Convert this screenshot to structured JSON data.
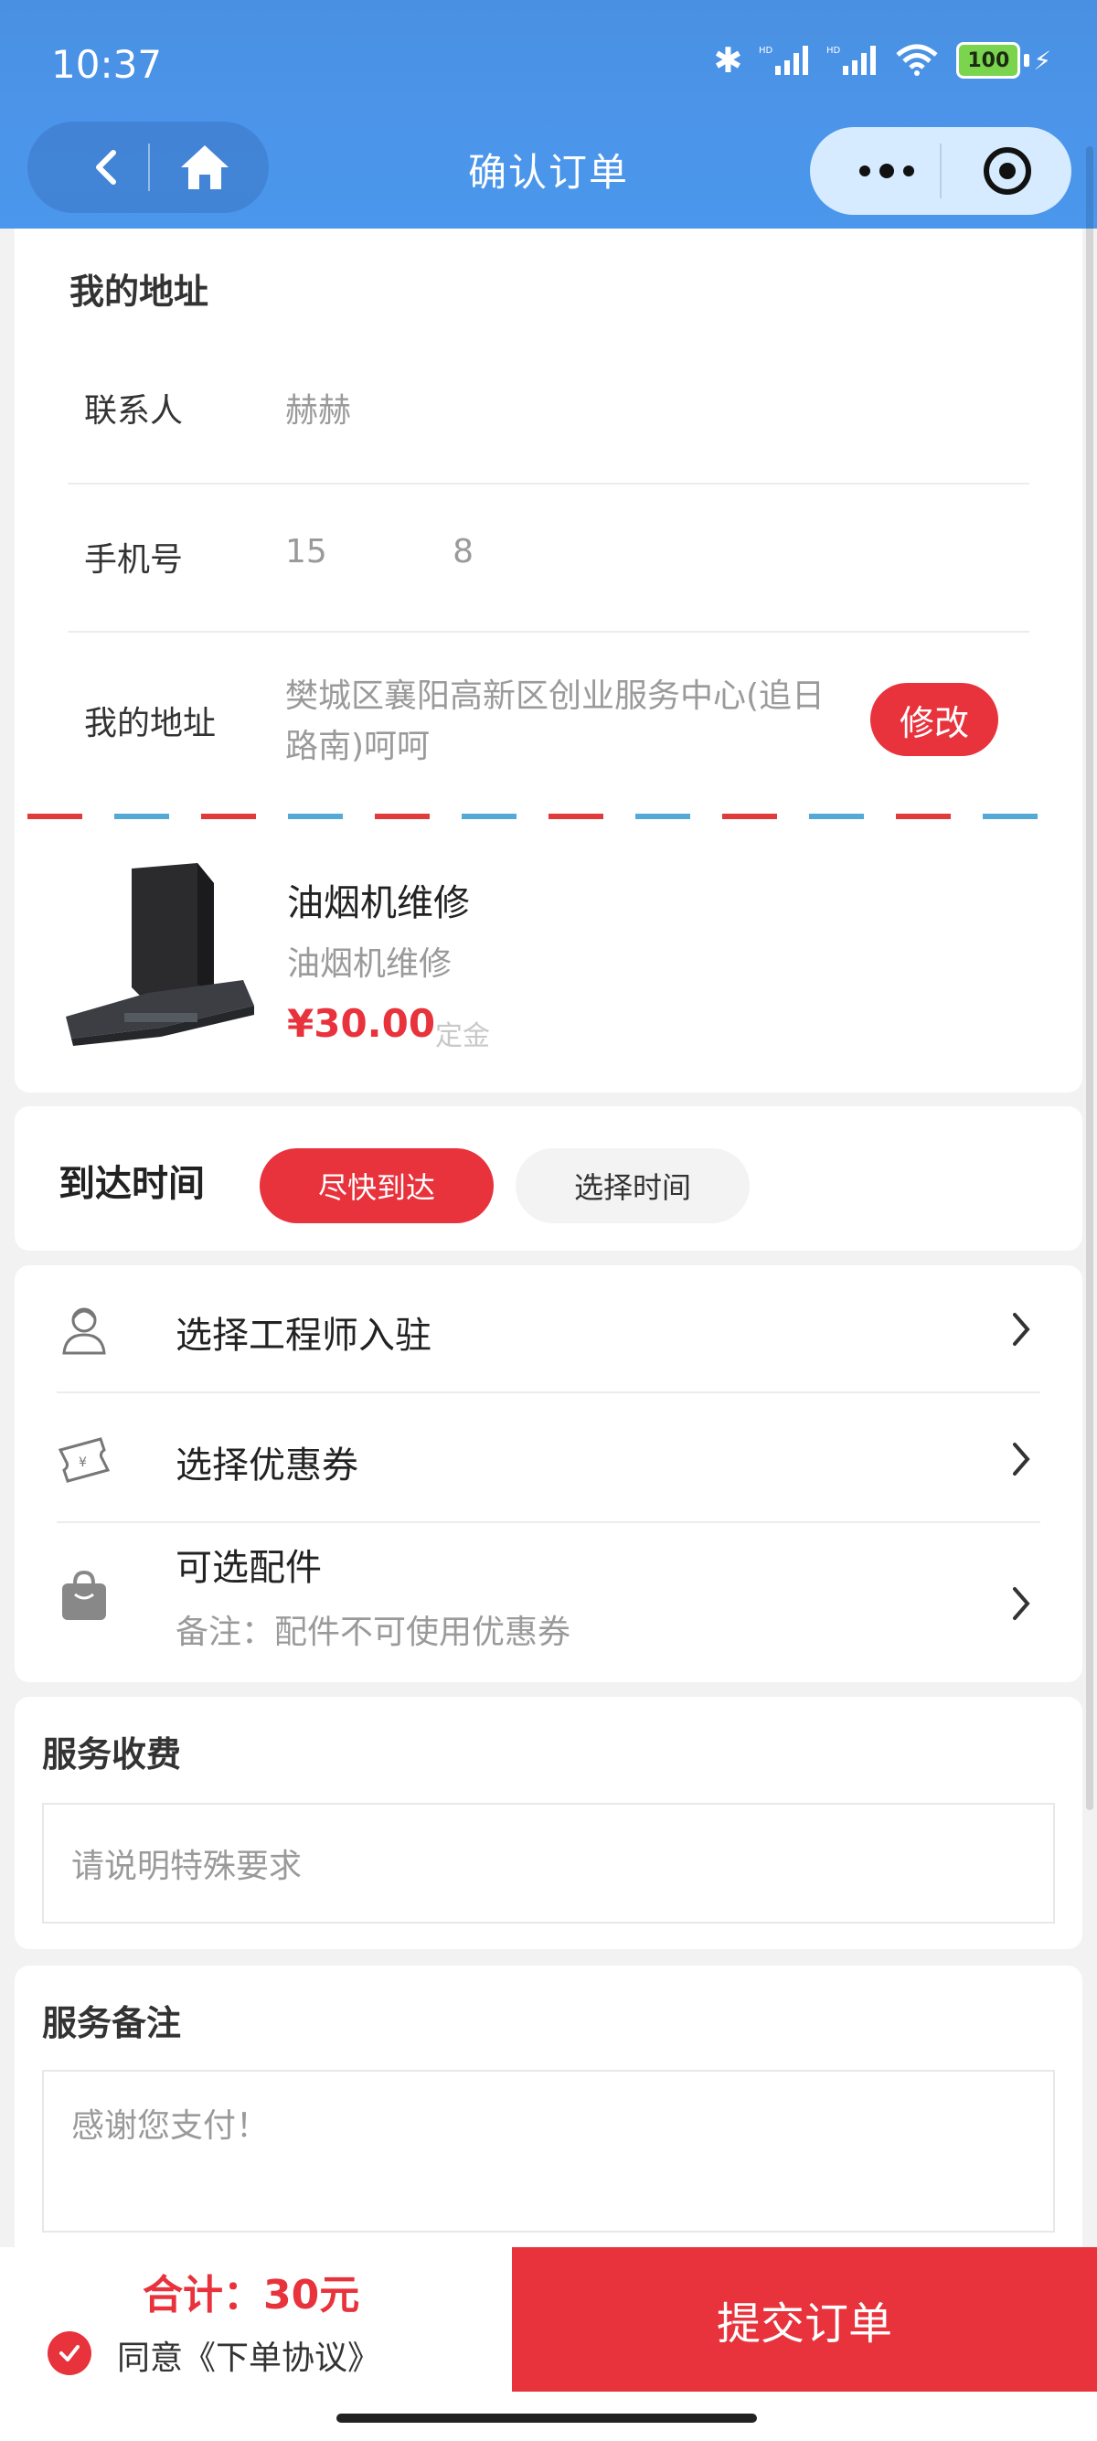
{
  "status_bar": {
    "time": "10:37",
    "battery": "100"
  },
  "nav": {
    "title": "确认订单"
  },
  "address": {
    "section_title": "我的地址",
    "contact_label": "联系人",
    "contact_value": "赫赫",
    "phone_label": "手机号",
    "phone_value": "15            8",
    "address_label": "我的地址",
    "address_value": "樊城区襄阳高新区创业服务中心(追日路南)呵呵",
    "edit_button": "修改"
  },
  "product": {
    "name": "油烟机维修",
    "subtitle": "油烟机维修",
    "price": "¥30.00",
    "price_unit": "定金"
  },
  "arrival": {
    "label": "到达时间",
    "option_asap": "尽快到达",
    "option_choose": "选择时间"
  },
  "options": [
    {
      "label": "选择工程师入驻",
      "icon": "engineer-icon"
    },
    {
      "label": "选择优惠券",
      "icon": "coupon-icon"
    },
    {
      "label": "可选配件",
      "note": "备注：配件不可使用优惠券",
      "icon": "bag-icon"
    }
  ],
  "fee": {
    "title": "服务收费",
    "placeholder": "请说明特殊要求"
  },
  "remark": {
    "title": "服务备注",
    "placeholder": "感谢您支付！"
  },
  "footer": {
    "total": "合计：30元",
    "agree_text": "同意《下单协议》",
    "submit": "提交订单"
  },
  "colors": {
    "accent": "#e8323c",
    "header_blue": "#4a90e2"
  }
}
